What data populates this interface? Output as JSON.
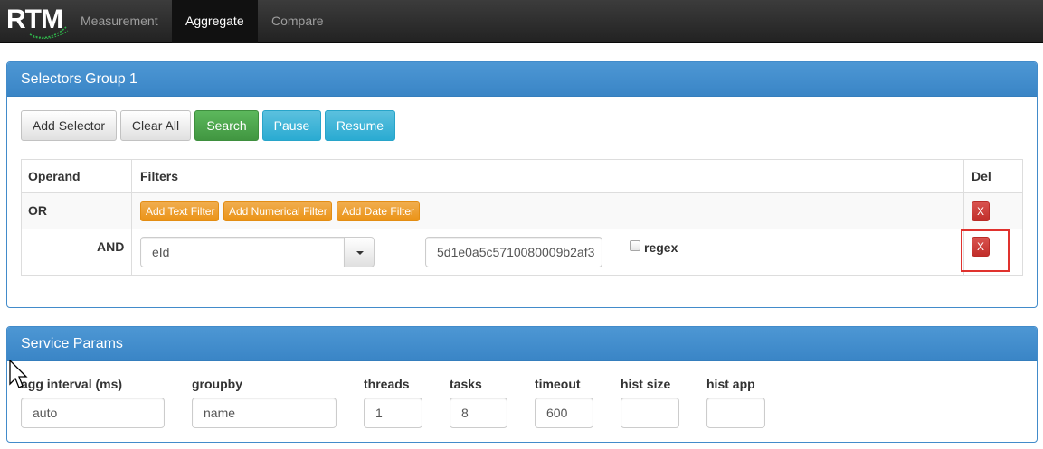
{
  "navbar": {
    "brand": "RTM",
    "tabs": [
      {
        "label": "Measurement",
        "active": false
      },
      {
        "label": "Aggregate",
        "active": true
      },
      {
        "label": "Compare",
        "active": false
      }
    ]
  },
  "selectors_panel": {
    "title": "Selectors Group 1",
    "buttons": {
      "add_selector": "Add Selector",
      "clear_all": "Clear All",
      "search": "Search",
      "pause": "Pause",
      "resume": "Resume"
    },
    "table": {
      "headers": {
        "operand": "Operand",
        "filters": "Filters",
        "del": "Del"
      },
      "or_row": {
        "operand": "OR",
        "filter_buttons": [
          "Add Text Filter",
          "Add Numerical Filter",
          "Add Date Filter"
        ],
        "del_label": "X"
      },
      "and_row": {
        "operand": "AND",
        "field_value": "eId",
        "value": "5d1e0a5c5710080009b2af3",
        "regex_label": "regex",
        "regex_checked": false,
        "del_label": "X"
      }
    }
  },
  "service_params": {
    "title": "Service Params",
    "fields": [
      {
        "label": "agg interval (ms)",
        "value": "auto"
      },
      {
        "label": "groupby",
        "value": "name"
      },
      {
        "label": "threads",
        "value": "1"
      },
      {
        "label": "tasks",
        "value": "8"
      },
      {
        "label": "timeout",
        "value": "600"
      },
      {
        "label": "hist size",
        "value": ""
      },
      {
        "label": "hist app",
        "value": ""
      }
    ]
  },
  "colors": {
    "navbar": "#222222",
    "panel_primary": "#428bca",
    "success": "#5cb85c",
    "info": "#5bc0de",
    "warning": "#f0ad4e",
    "danger": "#d9534f",
    "highlight": "#e0322e"
  }
}
